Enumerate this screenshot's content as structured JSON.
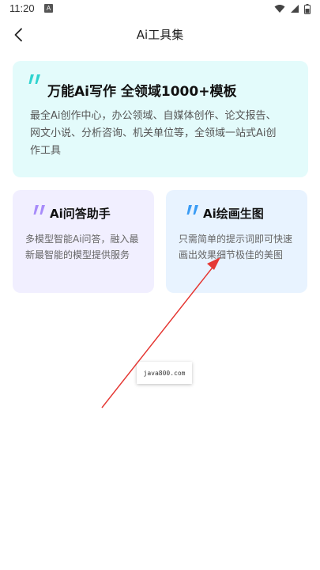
{
  "status_bar": {
    "time": "11:20",
    "notification_glyph": "A"
  },
  "header": {
    "title": "Ai工具集"
  },
  "hero": {
    "title": "万能Ai写作 全领域1000+模板",
    "description": "最全Ai创作中心，办公领域、自媒体创作、论文报告、网文小说、分析咨询、机关单位等，全领域一站式Ai创作工具",
    "quote_color": "#2ed3cf",
    "background": "#e3fbfb"
  },
  "tools": [
    {
      "title": "Ai问答助手",
      "description": "多模型智能Ai问答，融入最新最智能的模型提供服务",
      "quote_color": "#a78bfa",
      "background": "#f1efff"
    },
    {
      "title": "Ai绘画生图",
      "description": "只需简单的提示词即可快速画出效果细节极佳的美图",
      "quote_color": "#3a9cf5",
      "background": "#e8f3ff"
    }
  ],
  "watermark": {
    "text": "java800.com"
  },
  "icons": {
    "back": "chevron-left-icon",
    "wifi": "wifi-icon",
    "signal": "signal-icon",
    "battery": "battery-icon",
    "quote": "quote-mark-icon"
  },
  "annotation": {
    "arrow_color": "#e53935"
  }
}
